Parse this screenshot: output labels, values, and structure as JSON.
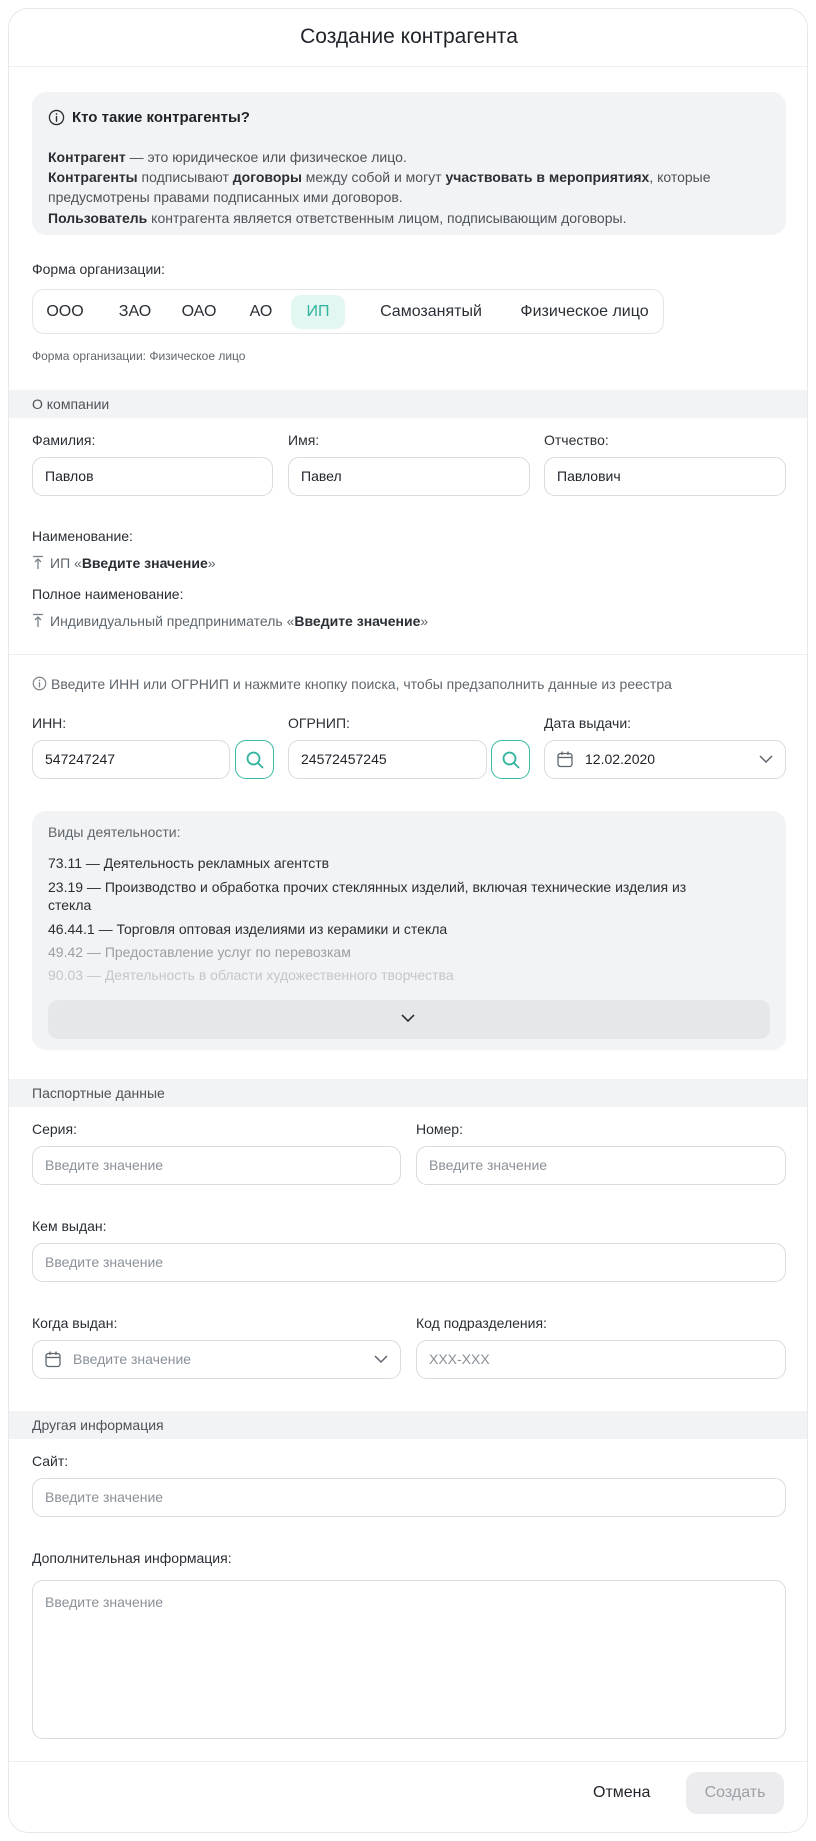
{
  "dialog": {
    "title": "Создание контрагента"
  },
  "info": {
    "title": "Кто такие контрагенты?",
    "line1_bold": "Контрагент",
    "line1_rest": " — это юридическое или физическое лицо.",
    "line2_a_bold": "Контрагенты",
    "line2_b": " подписывают ",
    "line2_c_bold": "договоры",
    "line2_d": " между собой и могут ",
    "line2_e_bold": "участвовать в мероприятиях",
    "line2_f": ", которые",
    "line3": "предусмотрены правами подписанных ими договоров.",
    "line4_bold": "Пользователь",
    "line4_rest": " контрагента является ответственным лицом, подписывающим договоры."
  },
  "org_form": {
    "label": "Форма организации:",
    "options": [
      "ООО",
      "ЗАО",
      "ОАО",
      "АО",
      "ИП",
      "Самозанятый",
      "Физическое лицо"
    ],
    "selected": "ИП",
    "hint": "Форма организации: Физическое лицо"
  },
  "company": {
    "section_title": "О компании",
    "last_name_label": "Фамилия:",
    "last_name_value": "Павлов",
    "first_name_label": "Имя:",
    "first_name_value": "Павел",
    "middle_name_label": "Отчество:",
    "middle_name_value": "Павлович",
    "name_label": "Наименование:",
    "name_prefix": "ИП «",
    "name_value": "Введите значение",
    "name_suffix": "»",
    "full_name_label": "Полное наименование:",
    "full_name_prefix": "Индивидуальный предприниматель «",
    "full_name_value": "Введите значение",
    "full_name_suffix": "»"
  },
  "registry": {
    "hint": "Введите ИНН или ОГРНИП и нажмите кнопку поиска, чтобы предзаполнить данные из реестра",
    "inn_label": "ИНН:",
    "inn_value": "547247247",
    "ogrnip_label": "ОГРНИП:",
    "ogrnip_value": "24572457245",
    "issue_date_label": "Дата выдачи:",
    "issue_date_value": "12.02.2020"
  },
  "activities": {
    "label": "Виды деятельности:",
    "items": [
      {
        "code": "73.11",
        "text": " — Деятельность рекламных агентств"
      },
      {
        "code": "23.19",
        "text": " — Производство и обработка прочих стеклянных изделий, включая технические изделия из"
      },
      {
        "code": "",
        "text": "стекла"
      },
      {
        "code": "46.44.1",
        "text": " — Торговля оптовая изделиями из керамики и стекла"
      },
      {
        "code": "49.42",
        "text": " — Предоставление услуг по перевозкам"
      },
      {
        "code": "90.03",
        "text": " — Деятельность в области художественного творчества"
      }
    ]
  },
  "passport": {
    "section_title": "Паспортные данные",
    "series_label": "Серия:",
    "series_placeholder": "Введите значение",
    "number_label": "Номер:",
    "number_placeholder": "Введите значение",
    "issued_by_label": "Кем выдан:",
    "issued_by_placeholder": "Введите значение",
    "issued_date_label": "Когда выдан:",
    "issued_date_placeholder": "Введите значение",
    "division_code_label": "Код подразделения:",
    "division_code_placeholder": "XXX-XXX"
  },
  "other": {
    "section_title": "Другая информация",
    "site_label": "Сайт:",
    "site_placeholder": "Введите значение",
    "extra_label": "Дополнительная информация:",
    "extra_placeholder": "Введите значение"
  },
  "footer": {
    "cancel_label": "Отмена",
    "create_label": "Создать"
  },
  "colors": {
    "accent": "#30b49e",
    "accent_bg": "#e2f6f2",
    "section_bg": "#f2f3f4"
  }
}
